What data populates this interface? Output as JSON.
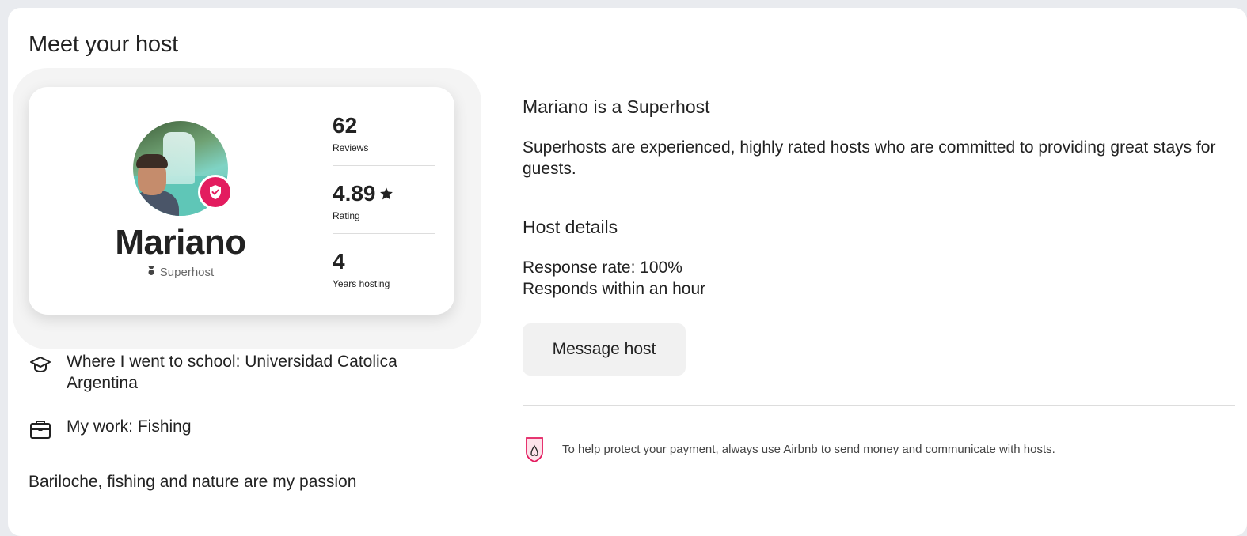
{
  "section": {
    "title": "Meet your host"
  },
  "host": {
    "name": "Mariano",
    "role_label": "Superhost",
    "avatar_icon": "host-avatar-photo",
    "verified_icon": "shield-check-icon",
    "role_icon": "superhost-medal-icon"
  },
  "stats": [
    {
      "value": "62",
      "label": "Reviews",
      "icon": null
    },
    {
      "value": "4.89",
      "label": "Rating",
      "icon": "star-icon"
    },
    {
      "value": "4",
      "label": "Years hosting",
      "icon": null
    }
  ],
  "facts": [
    {
      "icon": "graduation-cap-icon",
      "text": "Where I went to school: Universidad Catolica Argentina"
    },
    {
      "icon": "briefcase-icon",
      "text": "My work: Fishing"
    }
  ],
  "bio": "Bariloche, fishing and nature are my passion",
  "superhost": {
    "title": "Mariano is a Superhost",
    "description": "Superhosts are experienced, highly rated hosts who are committed to providing great stays for guests."
  },
  "host_details": {
    "title": "Host details",
    "response_rate": "Response rate: 100%",
    "response_time": "Responds within an hour"
  },
  "actions": {
    "message_label": "Message host"
  },
  "notice": {
    "icon": "payment-protection-icon",
    "text": "To help protect your payment, always use Airbnb to send money and communicate with hosts."
  },
  "colors": {
    "brand": "#e31c5f",
    "background": "#e9ebef",
    "text": "#222222",
    "muted": "#6a6a6a",
    "button_bg": "#f1f1f1"
  }
}
